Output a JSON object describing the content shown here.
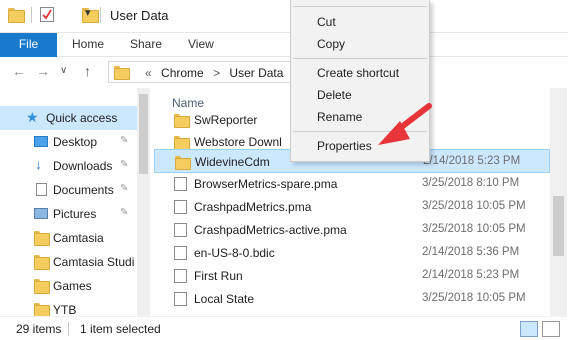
{
  "window": {
    "title": "User Data"
  },
  "ribbon": {
    "tabs": [
      "File",
      "Home",
      "Share",
      "View"
    ]
  },
  "address": {
    "parts": [
      "«",
      "Chrome",
      ">",
      "User Data"
    ]
  },
  "navpane": {
    "quick_access": "Quick access",
    "items": [
      {
        "label": "Desktop",
        "pinned": true,
        "icon": "desktop-icon"
      },
      {
        "label": "Downloads",
        "pinned": true,
        "icon": "download-icon"
      },
      {
        "label": "Documents",
        "pinned": true,
        "icon": "documents-icon"
      },
      {
        "label": "Pictures",
        "pinned": true,
        "icon": "pictures-icon"
      },
      {
        "label": "Camtasia",
        "pinned": false,
        "icon": "folder-icon"
      },
      {
        "label": "Camtasia Studi",
        "pinned": false,
        "icon": "folder-icon"
      },
      {
        "label": "Games",
        "pinned": false,
        "icon": "folder-icon"
      },
      {
        "label": "YTB",
        "pinned": false,
        "icon": "folder-icon"
      }
    ]
  },
  "filelist": {
    "column_name": "Name",
    "rows": [
      {
        "name": "SwReporter",
        "date": "",
        "type": "folder"
      },
      {
        "name": "Webstore Downl",
        "date": "",
        "type": "folder"
      },
      {
        "name": "WidevineCdm",
        "date": "2/14/2018 5:23 PM",
        "type": "folder",
        "selected": true
      },
      {
        "name": "BrowserMetrics-spare.pma",
        "date": "3/25/2018 8:10 PM",
        "type": "file"
      },
      {
        "name": "CrashpadMetrics.pma",
        "date": "3/25/2018 10:05 PM",
        "type": "file"
      },
      {
        "name": "CrashpadMetrics-active.pma",
        "date": "3/25/2018 10:05 PM",
        "type": "file"
      },
      {
        "name": "en-US-8-0.bdic",
        "date": "2/14/2018 5:36 PM",
        "type": "file"
      },
      {
        "name": "First Run",
        "date": "2/14/2018 5:23 PM",
        "type": "file"
      },
      {
        "name": "Local State",
        "date": "3/25/2018 10:05 PM",
        "type": "file"
      }
    ]
  },
  "status": {
    "count": "29 items",
    "selected": "1 item selected"
  },
  "context_menu": {
    "items": [
      "Cut",
      "Copy",
      "Create shortcut",
      "Delete",
      "Rename",
      "Properties"
    ]
  },
  "colors": {
    "accent": "#1979ca",
    "selection": "#cce8ff",
    "arrow": "#e8353a"
  }
}
